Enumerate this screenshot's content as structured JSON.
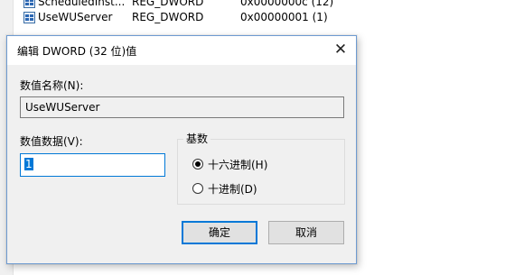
{
  "background": {
    "rows": [
      {
        "name": "ScheduledInst...",
        "type": "REG_DWORD",
        "value": "0x0000000c (12)"
      },
      {
        "name": "UseWUServer",
        "type": "REG_DWORD",
        "value": "0x00000001 (1)"
      }
    ]
  },
  "dialog": {
    "title": "编辑 DWORD (32 位)值",
    "close_glyph": "✕",
    "name_label": "数值名称(N):",
    "name_value": "UseWUServer",
    "data_label": "数值数据(V):",
    "data_value": "1",
    "base_label": "基数",
    "base_options": [
      {
        "label": "十六进制(H)",
        "selected": true
      },
      {
        "label": "十进制(D)",
        "selected": false
      }
    ],
    "ok_label": "确定",
    "cancel_label": "取消"
  },
  "colors": {
    "accent": "#0078d7",
    "dialog_bg": "#f0f0f0",
    "button_bg": "#e1e1e1"
  },
  "icons": {
    "registry_value": "reg-dword-icon"
  }
}
